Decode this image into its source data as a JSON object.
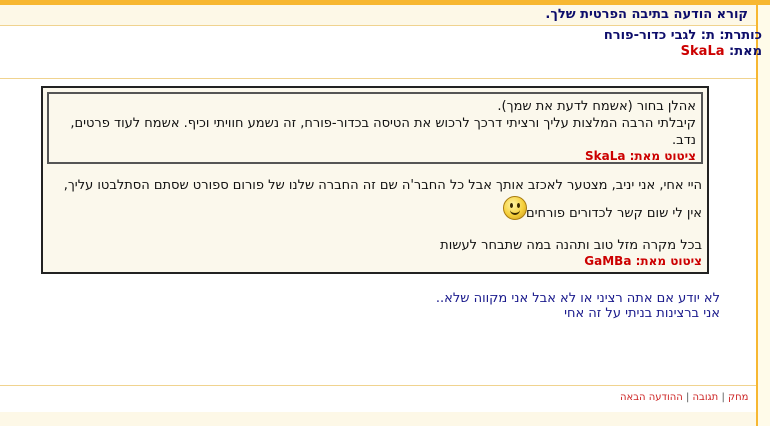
{
  "header": {
    "title": "קורא הודעה בתיבה הפרטית שלך."
  },
  "message": {
    "subject_label": "כותרת:",
    "subject": "ת: לגבי כדור-פורח",
    "from_label": "מאת:",
    "from": "SkaLa"
  },
  "quote": {
    "inner": {
      "lines": [
        "אהלן בחור (אשמח לדעת את שמך).",
        "קיבלתי הרבה המלצות עליך ורציתי דרכך לרכוש את הטיסה בכדור-פורח, זה נשמע חוויתי וכיף. אשמח לעוד פרטים,",
        "נדב."
      ],
      "cite": "ציטוט מאת: SkaLa"
    },
    "outer": {
      "line1": "היי אחי, אני יניב, מצטער לאכזב אותך אבל כל החבר'ה שם זה החברה שלנו של פורום ספורט שסתם הסתלבטו עליך,",
      "line2": "אין לי שום קשר לכדורים פורחים",
      "line3": "בכל מקרה מזל טוב ותהנה במה שתבחר לעשות",
      "cite": "ציטוט מאת: GaMBa"
    }
  },
  "reply": {
    "line1": "לא יודע אם אתה רציני או לא אבל אני מקווה שלא..",
    "line2": "אני ברצינות בניתי על זה אחי"
  },
  "actions": {
    "delete": "מחק",
    "reply": "תגובה",
    "next": "ההודעה הבאה",
    "separator": "|"
  },
  "colors": {
    "accent": "#f7b731",
    "cite": "#cc0000",
    "text_blue": "#1a1a8c"
  },
  "icons": {
    "smiley": "smiley-face-icon"
  }
}
